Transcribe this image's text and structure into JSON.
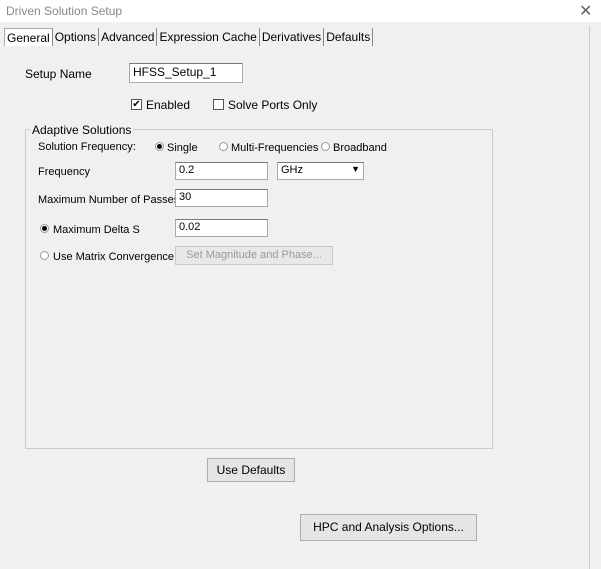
{
  "window": {
    "title": "Driven Solution Setup",
    "close_icon": "close-icon"
  },
  "tabs": [
    {
      "label": "General",
      "active": true
    },
    {
      "label": "Options"
    },
    {
      "label": "Advanced"
    },
    {
      "label": "Expression Cache"
    },
    {
      "label": "Derivatives"
    },
    {
      "label": "Defaults"
    }
  ],
  "general": {
    "setup_name_label": "Setup Name",
    "setup_name_value": "HFSS_Setup_1",
    "enabled_label": "Enabled",
    "enabled_checked": true,
    "solve_ports_label": "Solve Ports Only",
    "solve_ports_checked": false,
    "adaptive": {
      "title": "Adaptive Solutions",
      "solution_frequency_label": "Solution Frequency:",
      "freq_options": [
        {
          "label": "Single",
          "selected": true
        },
        {
          "label": "Multi-Frequencies",
          "selected": false
        },
        {
          "label": "Broadband",
          "selected": false
        }
      ],
      "frequency_label": "Frequency",
      "frequency_value": "0.2",
      "frequency_unit": "GHz",
      "max_passes_label": "Maximum Number of Passes",
      "max_passes_value": "30",
      "max_delta_s_label": "Maximum Delta S",
      "max_delta_s_value": "0.02",
      "max_delta_s_selected": true,
      "matrix_conv_label": "Use Matrix Convergence",
      "matrix_conv_selected": false,
      "set_mag_phase_label": "Set Magnitude and Phase..."
    },
    "use_defaults_label": "Use Defaults",
    "hpc_label": "HPC and Analysis Options..."
  }
}
